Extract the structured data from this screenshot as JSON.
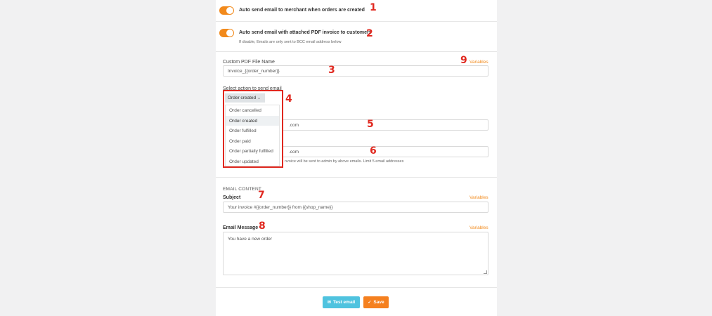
{
  "settings": {
    "toggle1_label": "Auto send email to merchant when orders are created",
    "toggle2_label": "Auto send email with attached PDF invoice to customers",
    "toggle2_hint": "If disable, Emails are only sent to BCC email address below",
    "pdf_name_label": "Custom PDF File Name",
    "pdf_name_value": "Invoice_{{order_number}}",
    "variables_link": "Variables",
    "action_label": "Select action to send email",
    "action_selected": "Order created",
    "action_options": [
      "Order cancelled",
      "Order created",
      "Order fulfilled",
      "Order paid",
      "Order partially fulfilled",
      "Order updated"
    ],
    "email1_value_partial": ".com",
    "email2_value_partial": ".com",
    "email2_hint_partial": "nvoice will be sent to admin by above emails. Limit 5 email addresses"
  },
  "email_content": {
    "section_title": "EMAIL CONTENT",
    "subject_label": "Subject",
    "subject_value": "Your invoice #{{order_number}} from {{shop_name}}",
    "message_label": "Email Message",
    "message_value": "You have a new order",
    "variables_link": "Variables"
  },
  "buttons": {
    "test_email": "Test email",
    "save": "Save"
  },
  "annotations": {
    "n1": "1",
    "n2": "2",
    "n3": "3",
    "n4": "4",
    "n5": "5",
    "n6": "6",
    "n7": "7",
    "n8": "8",
    "n9": "9"
  },
  "colors": {
    "accent": "#f28a1c",
    "annotation_red": "#e0281f",
    "test_button": "#4fc3df",
    "save_button": "#f5801f"
  }
}
